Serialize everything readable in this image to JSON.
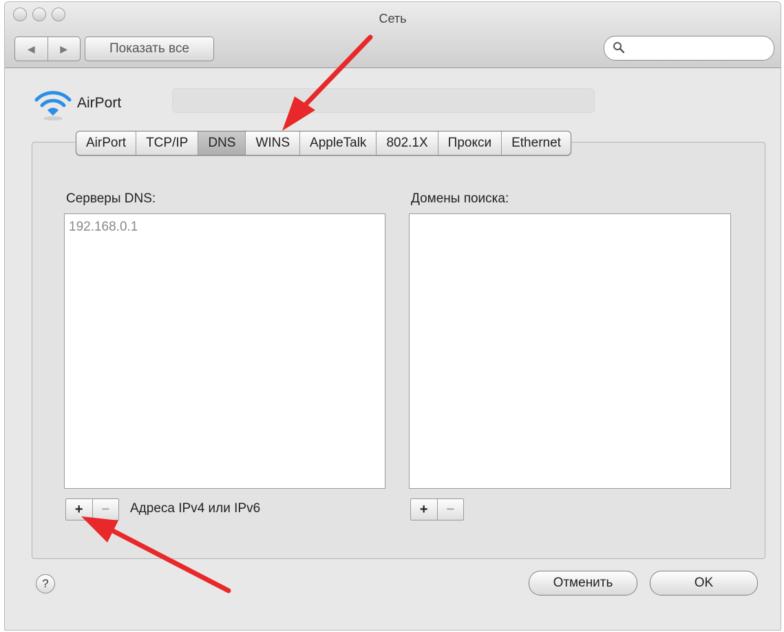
{
  "window": {
    "title": "Сеть"
  },
  "toolbar": {
    "back": "◀",
    "forward": "▶",
    "show_all": "Показать все",
    "search_placeholder": ""
  },
  "interface": {
    "name": "AirPort"
  },
  "tabs": [
    {
      "label": "AirPort",
      "active": false
    },
    {
      "label": "TCP/IP",
      "active": false
    },
    {
      "label": "DNS",
      "active": true
    },
    {
      "label": "WINS",
      "active": false
    },
    {
      "label": "AppleTalk",
      "active": false
    },
    {
      "label": "802.1X",
      "active": false
    },
    {
      "label": "Прокси",
      "active": false
    },
    {
      "label": "Ethernet",
      "active": false
    }
  ],
  "dns": {
    "servers_label": "Серверы DNS:",
    "servers": [
      "192.168.0.1"
    ],
    "domains_label": "Домены поиска:",
    "domains": [],
    "plus": "+",
    "minus": "−",
    "hint": "Адреса IPv4 или IPv6"
  },
  "footer": {
    "help": "?",
    "cancel": "Отменить",
    "ok": "OK"
  },
  "colors": {
    "arrow": "#e8282a",
    "airport_icon": "#2c8fe6"
  }
}
